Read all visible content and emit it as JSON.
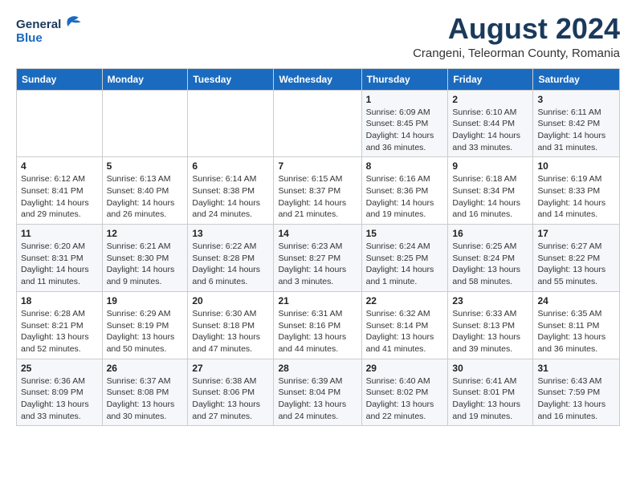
{
  "header": {
    "logo_line1": "General",
    "logo_line2": "Blue",
    "month_year": "August 2024",
    "location": "Crangeni, Teleorman County, Romania"
  },
  "weekdays": [
    "Sunday",
    "Monday",
    "Tuesday",
    "Wednesday",
    "Thursday",
    "Friday",
    "Saturday"
  ],
  "weeks": [
    [
      {
        "day": "",
        "info": ""
      },
      {
        "day": "",
        "info": ""
      },
      {
        "day": "",
        "info": ""
      },
      {
        "day": "",
        "info": ""
      },
      {
        "day": "1",
        "info": "Sunrise: 6:09 AM\nSunset: 8:45 PM\nDaylight: 14 hours\nand 36 minutes."
      },
      {
        "day": "2",
        "info": "Sunrise: 6:10 AM\nSunset: 8:44 PM\nDaylight: 14 hours\nand 33 minutes."
      },
      {
        "day": "3",
        "info": "Sunrise: 6:11 AM\nSunset: 8:42 PM\nDaylight: 14 hours\nand 31 minutes."
      }
    ],
    [
      {
        "day": "4",
        "info": "Sunrise: 6:12 AM\nSunset: 8:41 PM\nDaylight: 14 hours\nand 29 minutes."
      },
      {
        "day": "5",
        "info": "Sunrise: 6:13 AM\nSunset: 8:40 PM\nDaylight: 14 hours\nand 26 minutes."
      },
      {
        "day": "6",
        "info": "Sunrise: 6:14 AM\nSunset: 8:38 PM\nDaylight: 14 hours\nand 24 minutes."
      },
      {
        "day": "7",
        "info": "Sunrise: 6:15 AM\nSunset: 8:37 PM\nDaylight: 14 hours\nand 21 minutes."
      },
      {
        "day": "8",
        "info": "Sunrise: 6:16 AM\nSunset: 8:36 PM\nDaylight: 14 hours\nand 19 minutes."
      },
      {
        "day": "9",
        "info": "Sunrise: 6:18 AM\nSunset: 8:34 PM\nDaylight: 14 hours\nand 16 minutes."
      },
      {
        "day": "10",
        "info": "Sunrise: 6:19 AM\nSunset: 8:33 PM\nDaylight: 14 hours\nand 14 minutes."
      }
    ],
    [
      {
        "day": "11",
        "info": "Sunrise: 6:20 AM\nSunset: 8:31 PM\nDaylight: 14 hours\nand 11 minutes."
      },
      {
        "day": "12",
        "info": "Sunrise: 6:21 AM\nSunset: 8:30 PM\nDaylight: 14 hours\nand 9 minutes."
      },
      {
        "day": "13",
        "info": "Sunrise: 6:22 AM\nSunset: 8:28 PM\nDaylight: 14 hours\nand 6 minutes."
      },
      {
        "day": "14",
        "info": "Sunrise: 6:23 AM\nSunset: 8:27 PM\nDaylight: 14 hours\nand 3 minutes."
      },
      {
        "day": "15",
        "info": "Sunrise: 6:24 AM\nSunset: 8:25 PM\nDaylight: 14 hours\nand 1 minute."
      },
      {
        "day": "16",
        "info": "Sunrise: 6:25 AM\nSunset: 8:24 PM\nDaylight: 13 hours\nand 58 minutes."
      },
      {
        "day": "17",
        "info": "Sunrise: 6:27 AM\nSunset: 8:22 PM\nDaylight: 13 hours\nand 55 minutes."
      }
    ],
    [
      {
        "day": "18",
        "info": "Sunrise: 6:28 AM\nSunset: 8:21 PM\nDaylight: 13 hours\nand 52 minutes."
      },
      {
        "day": "19",
        "info": "Sunrise: 6:29 AM\nSunset: 8:19 PM\nDaylight: 13 hours\nand 50 minutes."
      },
      {
        "day": "20",
        "info": "Sunrise: 6:30 AM\nSunset: 8:18 PM\nDaylight: 13 hours\nand 47 minutes."
      },
      {
        "day": "21",
        "info": "Sunrise: 6:31 AM\nSunset: 8:16 PM\nDaylight: 13 hours\nand 44 minutes."
      },
      {
        "day": "22",
        "info": "Sunrise: 6:32 AM\nSunset: 8:14 PM\nDaylight: 13 hours\nand 41 minutes."
      },
      {
        "day": "23",
        "info": "Sunrise: 6:33 AM\nSunset: 8:13 PM\nDaylight: 13 hours\nand 39 minutes."
      },
      {
        "day": "24",
        "info": "Sunrise: 6:35 AM\nSunset: 8:11 PM\nDaylight: 13 hours\nand 36 minutes."
      }
    ],
    [
      {
        "day": "25",
        "info": "Sunrise: 6:36 AM\nSunset: 8:09 PM\nDaylight: 13 hours\nand 33 minutes."
      },
      {
        "day": "26",
        "info": "Sunrise: 6:37 AM\nSunset: 8:08 PM\nDaylight: 13 hours\nand 30 minutes."
      },
      {
        "day": "27",
        "info": "Sunrise: 6:38 AM\nSunset: 8:06 PM\nDaylight: 13 hours\nand 27 minutes."
      },
      {
        "day": "28",
        "info": "Sunrise: 6:39 AM\nSunset: 8:04 PM\nDaylight: 13 hours\nand 24 minutes."
      },
      {
        "day": "29",
        "info": "Sunrise: 6:40 AM\nSunset: 8:02 PM\nDaylight: 13 hours\nand 22 minutes."
      },
      {
        "day": "30",
        "info": "Sunrise: 6:41 AM\nSunset: 8:01 PM\nDaylight: 13 hours\nand 19 minutes."
      },
      {
        "day": "31",
        "info": "Sunrise: 6:43 AM\nSunset: 7:59 PM\nDaylight: 13 hours\nand 16 minutes."
      }
    ]
  ]
}
